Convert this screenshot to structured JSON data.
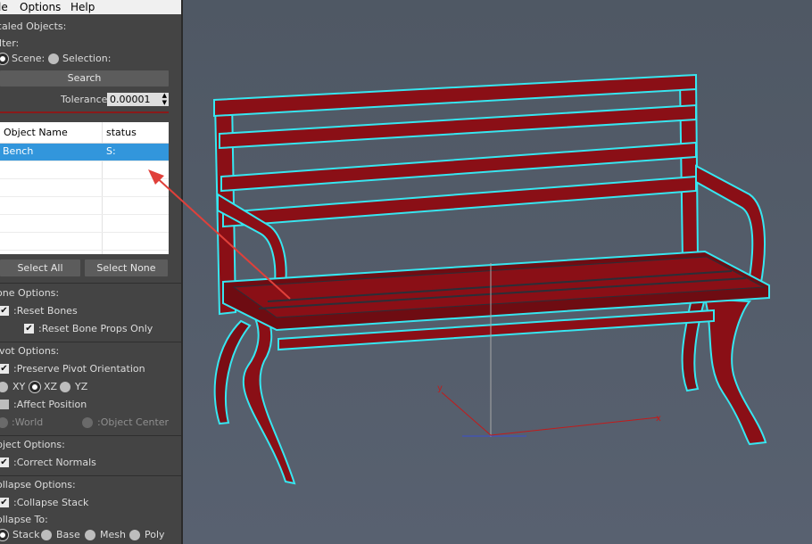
{
  "menu": {
    "items": [
      "le",
      "Options",
      "Help"
    ]
  },
  "panel": {
    "scaled_title": "caled Objects:",
    "filter_label": "ilter:",
    "filter_scene": "Scene:",
    "filter_selection": "Selection:",
    "search_button": "Search",
    "tolerance_label": "Tolerance:",
    "tolerance_value": "0.00001",
    "list": {
      "col_name": "Object Name",
      "col_status": "status",
      "rows": [
        {
          "name": "Bench",
          "status": "S:"
        }
      ]
    },
    "select_all": "Select All",
    "select_none": "Select None",
    "bone_title": "one Options:",
    "reset_bones": ":Reset Bones",
    "reset_bone_props": ":Reset Bone Props Only",
    "pivot_title": "ivot Options:",
    "preserve_pivot": ":Preserve Pivot Orientation",
    "axis_xy": "XY",
    "axis_xz": "XZ",
    "axis_yz": "YZ",
    "affect_position": ":Affect Position",
    "world": ":World",
    "object_center": ":Object Center",
    "object_title": "bject Options:",
    "correct_normals": ":Correct Normals",
    "collapse_title": "ollapse Options:",
    "collapse_stack": ":Collapse Stack",
    "collapse_to": "ollapse To:",
    "to_stack": "Stack",
    "to_base": "Base",
    "to_mesh": "Mesh",
    "to_poly": "Poly"
  },
  "viewport": {
    "gizmo_x": "x",
    "gizmo_y": "y"
  },
  "colors": {
    "bench": "#8a0f16",
    "outline": "#37e6f0",
    "arrow": "#e0403a",
    "selection": "#3296dc"
  }
}
